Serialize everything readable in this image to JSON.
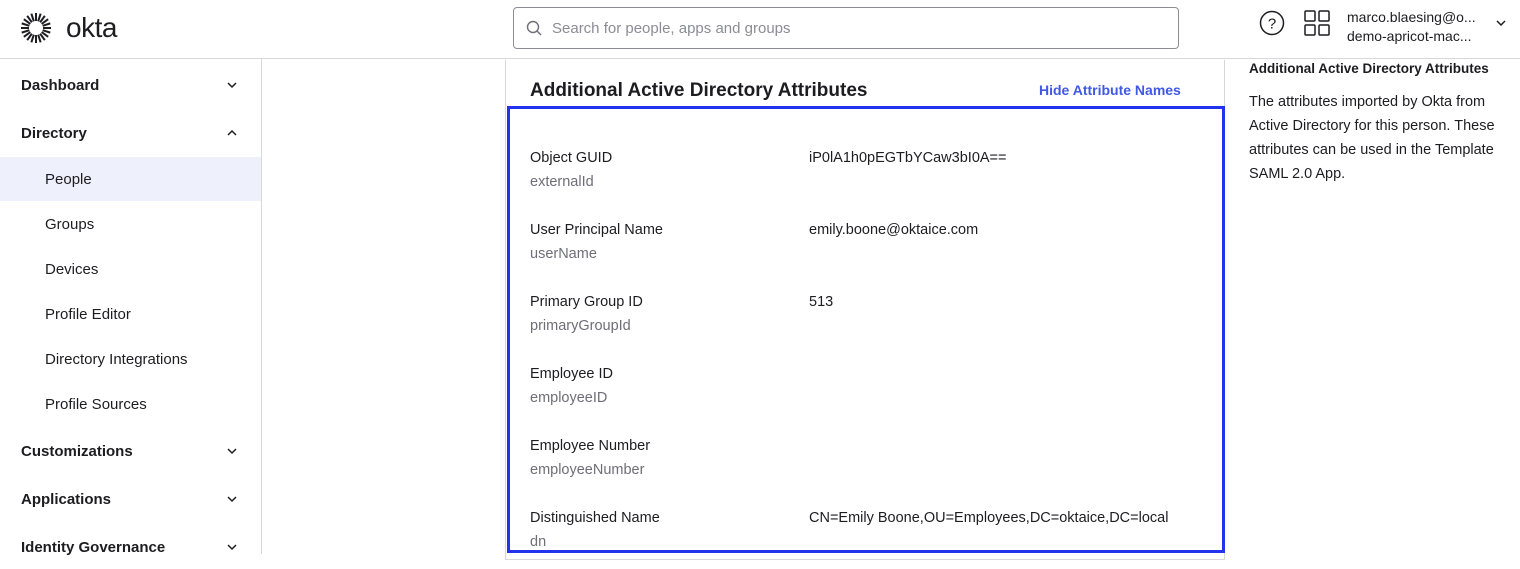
{
  "header": {
    "logo_text": "okta",
    "search_placeholder": "Search for people, apps and groups",
    "user_email": "marco.blaesing@o...",
    "user_org": "demo-apricot-mac..."
  },
  "sidebar": {
    "items": [
      {
        "label": "Dashboard",
        "type": "section",
        "expanded": false
      },
      {
        "label": "Directory",
        "type": "section",
        "expanded": true
      },
      {
        "label": "People",
        "type": "sub",
        "active": true
      },
      {
        "label": "Groups",
        "type": "sub"
      },
      {
        "label": "Devices",
        "type": "sub"
      },
      {
        "label": "Profile Editor",
        "type": "sub"
      },
      {
        "label": "Directory Integrations",
        "type": "sub"
      },
      {
        "label": "Profile Sources",
        "type": "sub"
      },
      {
        "label": "Customizations",
        "type": "section",
        "expanded": false
      },
      {
        "label": "Applications",
        "type": "section",
        "expanded": false
      },
      {
        "label": "Identity Governance",
        "type": "section",
        "expanded": false
      }
    ]
  },
  "card": {
    "title": "Additional Active Directory Attributes",
    "hide_link": "Hide Attribute Names",
    "rows": [
      {
        "label": "Object GUID",
        "name": "externalId",
        "value": "iP0lA1h0pEGTbYCaw3bI0A=="
      },
      {
        "label": "User Principal Name",
        "name": "userName",
        "value": "emily.boone@oktaice.com"
      },
      {
        "label": "Primary Group ID",
        "name": "primaryGroupId",
        "value": "513"
      },
      {
        "label": "Employee ID",
        "name": "employeeID",
        "value": ""
      },
      {
        "label": "Employee Number",
        "name": "employeeNumber",
        "value": ""
      },
      {
        "label": "Distinguished Name",
        "name": "dn",
        "value": "CN=Emily Boone,OU=Employees,DC=oktaice,DC=local"
      }
    ]
  },
  "info": {
    "title": "Additional Active Directory Attributes",
    "body": "The attributes imported by Okta from Active Directory for this person. These attributes can be used in the Template SAML 2.0 App."
  },
  "colors": {
    "accent": "#3f59e4",
    "highlight": "#2233ee",
    "active_bg": "#eef0fb"
  }
}
